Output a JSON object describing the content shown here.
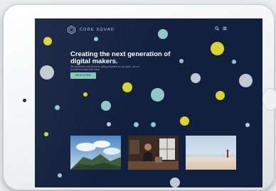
{
  "brand": {
    "name": "CODE SQUAD",
    "icon": "hexagon-logo-icon"
  },
  "nav": {
    "search_icon": "search-icon",
    "menu_icon": "menu-icon"
  },
  "hero": {
    "title": "Creating the next generation of digital makers.",
    "subtitle": "We modernize mind and new coding education for our youth. Join us to build and share their ideas.",
    "cta_label": "REGISTER"
  },
  "photos": [
    {
      "name": "mountain-photo",
      "alt": "Mountain landscape"
    },
    {
      "name": "workshop-photo",
      "alt": "Person at a workbench"
    },
    {
      "name": "beach-photo",
      "alt": "Person standing on a beach"
    }
  ],
  "colors": {
    "background": "#12203f",
    "cta": "#7fc8b5",
    "accent_yellow": "#d9d430",
    "accent_teal": "#8fc9c7",
    "accent_gray": "#c3c8d2"
  }
}
